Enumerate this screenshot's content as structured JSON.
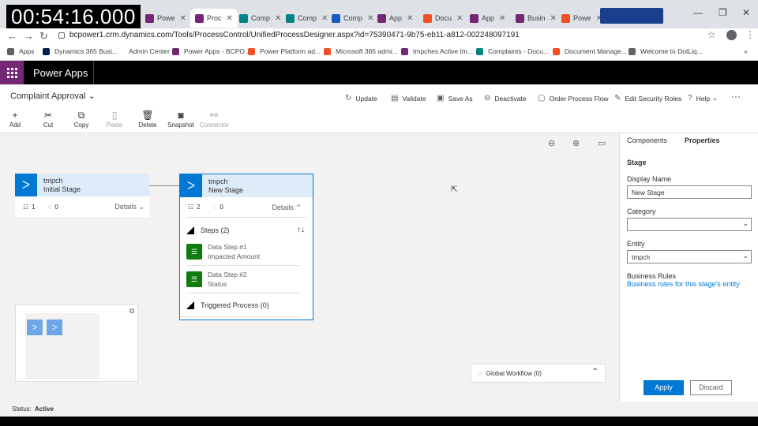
{
  "overlay": {
    "timer": "00:54:16.000"
  },
  "browser": {
    "tabs": [
      {
        "label": "Powe",
        "color": "#742774"
      },
      {
        "label": "Proc",
        "color": "#742774",
        "active": true
      },
      {
        "label": "Comp",
        "color": "#038387"
      },
      {
        "label": "Comp",
        "color": "#038387"
      },
      {
        "label": "Comp",
        "color": "#185abd"
      },
      {
        "label": "App",
        "color": "#742774"
      },
      {
        "label": "Docu",
        "color": "#f25022"
      },
      {
        "label": "App",
        "color": "#742774"
      },
      {
        "label": "Busin",
        "color": "#742774"
      },
      {
        "label": "Powe",
        "color": "#f25022"
      }
    ],
    "url": "bcpower1.crm.dynamics.com/Tools/ProcessControl/UnifiedProcessDesigner.aspx?id=75390471-9b75-eb11-a812-002248097191",
    "bookmarks": [
      {
        "label": "Apps",
        "color": "#5f6368"
      },
      {
        "label": "Dynamics 365 Busi...",
        "color": "#002050"
      },
      {
        "label": "Admin Center",
        "color": "#ffffff"
      },
      {
        "label": "Power Apps - BCPO...",
        "color": "#742774"
      },
      {
        "label": "Power Platform ad...",
        "color": "#f25022"
      },
      {
        "label": "Microsoft 365 admi...",
        "color": "#f25022"
      },
      {
        "label": "tmpches Active tm...",
        "color": "#742774"
      },
      {
        "label": "Complaints - Docu...",
        "color": "#038387"
      },
      {
        "label": "Document Manage...",
        "color": "#f25022"
      },
      {
        "label": "Welcome to DotLiq...",
        "color": "#5f6368"
      }
    ]
  },
  "app": {
    "name": "Power Apps"
  },
  "process": {
    "title": "Complaint Approval"
  },
  "commands": {
    "update": "Update",
    "validate": "Validate",
    "save_as": "Save As",
    "deactivate": "Deactivate",
    "order": "Order Process Flow",
    "security": "Edit Security Roles",
    "help": "Help"
  },
  "tools": {
    "add": "Add",
    "cut": "Cut",
    "copy": "Copy",
    "paste": "Paste",
    "delete": "Delete",
    "snapshot": "Snapshot",
    "connector": "Connector"
  },
  "stages": [
    {
      "entity": "tmpch",
      "name": "Initial Stage",
      "step_count": "1",
      "condition_count": "0",
      "details": "Details"
    },
    {
      "entity": "tmpch",
      "name": "New Stage",
      "step_count": "2",
      "condition_count": "0",
      "details": "Details",
      "steps_header": "Steps (2)",
      "steps": [
        {
          "title": "Data Step #1",
          "field": "Impacted Amount"
        },
        {
          "title": "Data Step #2",
          "field": "Status"
        }
      ],
      "triggered": "Triggered Process (0)"
    }
  ],
  "global_workflow": "Global Workflow (0)",
  "properties": {
    "tabs": [
      "Components",
      "Properties"
    ],
    "section": "Stage",
    "display_name_label": "Display Name",
    "display_name": "New Stage",
    "category_label": "Category",
    "category": "",
    "entity_label": "Entity",
    "entity": "tmpch",
    "business_rules_label": "Business Rules",
    "business_rules_link": "Business rules for this stage's entity",
    "apply": "Apply",
    "discard": "Discard"
  },
  "status": {
    "label": "Status:",
    "value": "Active"
  }
}
